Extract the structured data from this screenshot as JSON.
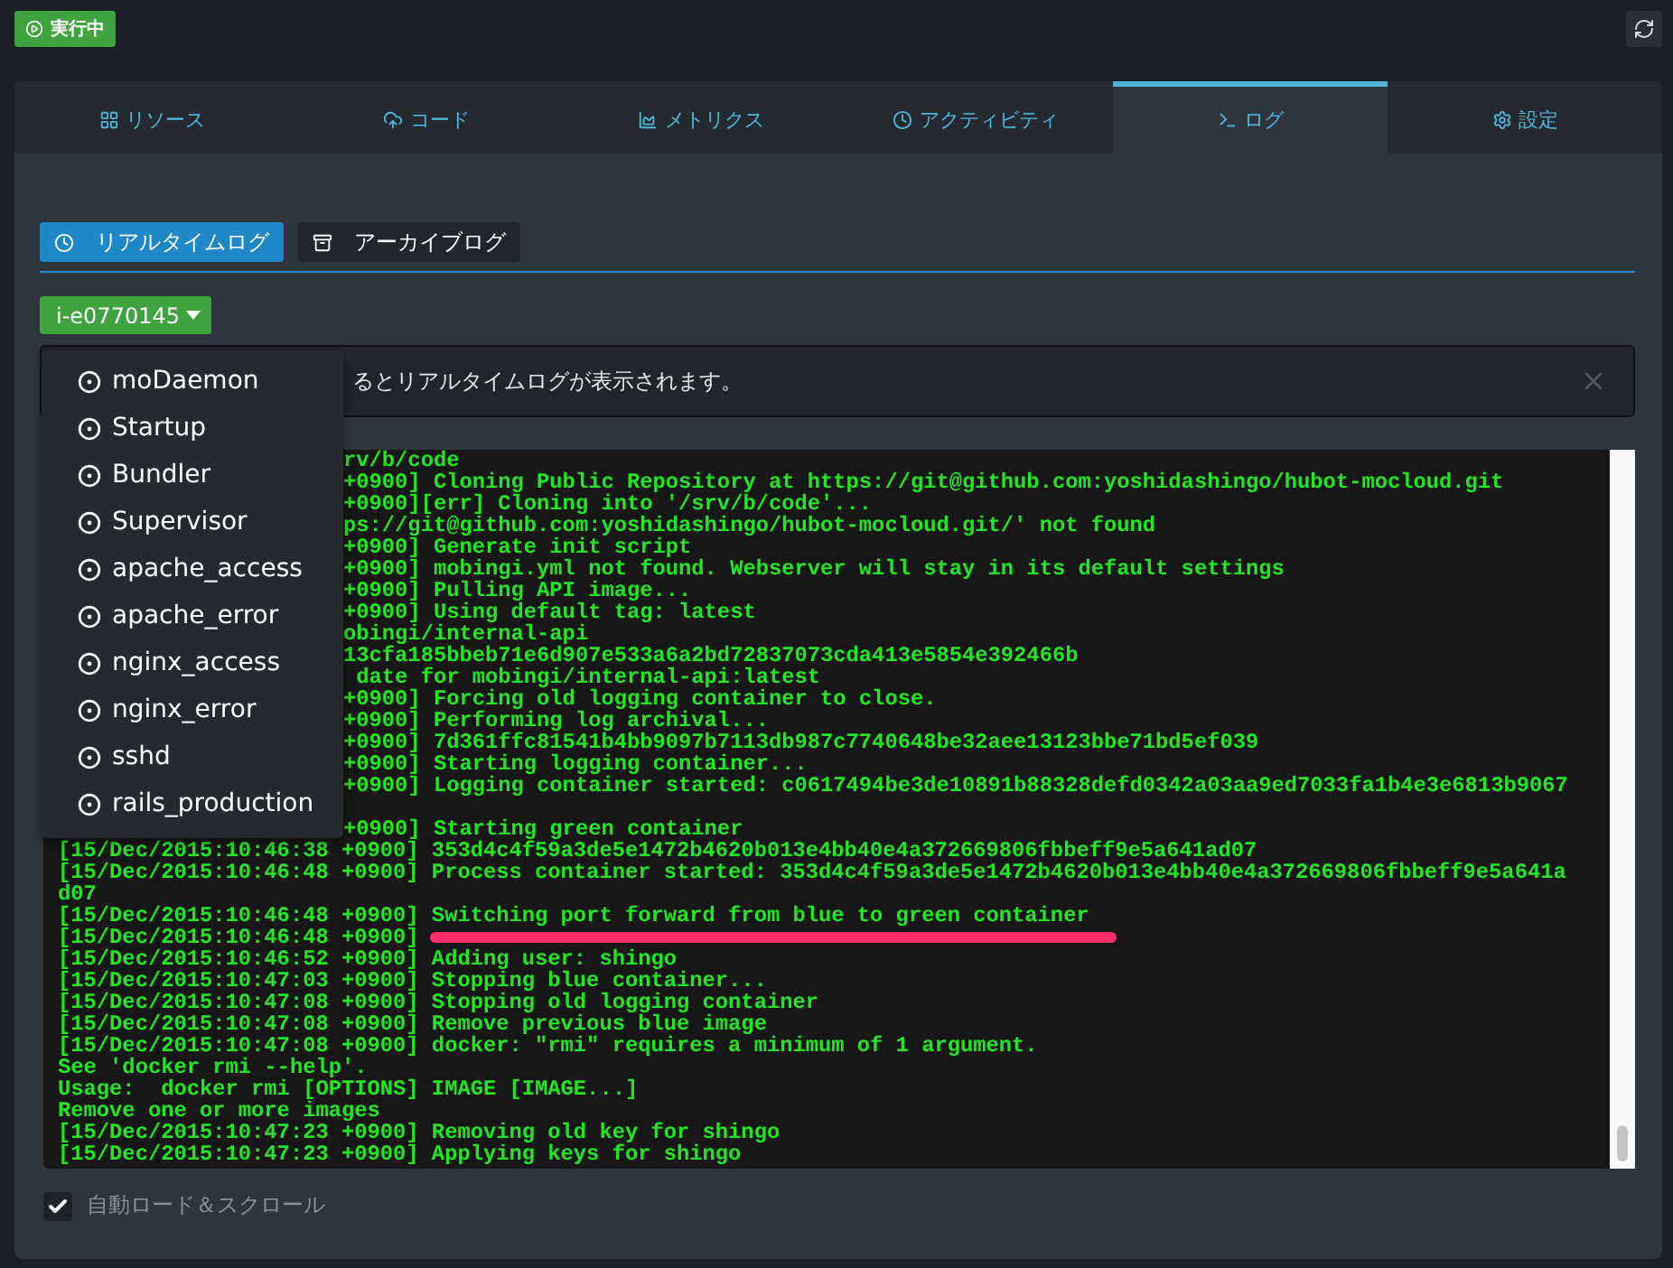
{
  "status": {
    "label": "実行中"
  },
  "tabs": [
    {
      "label": "リソース",
      "selected": false
    },
    {
      "label": "コード",
      "selected": false
    },
    {
      "label": "メトリクス",
      "selected": false
    },
    {
      "label": "アクティビティ",
      "selected": false
    },
    {
      "label": "ログ",
      "selected": true
    },
    {
      "label": "設定",
      "selected": false
    }
  ],
  "log_modes": [
    {
      "label": "リアルタイムログ",
      "selected": true
    },
    {
      "label": "アーカイブログ",
      "selected": false
    }
  ],
  "instance": {
    "label": "i-e0770145",
    "expanded": true
  },
  "menu_items": [
    "moDaemon",
    "Startup",
    "Bundler",
    "Supervisor",
    "apache_access",
    "apache_error",
    "nginx_access",
    "nginx_error",
    "sshd",
    "rails_production"
  ],
  "alert": {
    "text": "るとリアルタイムログが表示されます。"
  },
  "log_lines": [
    {
      "kind": "cut",
      "text": "rv/b/code"
    },
    {
      "kind": "cut",
      "text": "+0900] Cloning Public Repository at https://git@github.com:yoshidashingo/hubot-mocloud.git"
    },
    {
      "kind": "cut",
      "text": "+0900][err] Cloning into '/srv/b/code'..."
    },
    {
      "kind": "cut",
      "text": "ps://git@github.com:yoshidashingo/hubot-mocloud.git/' not found"
    },
    {
      "kind": "cut",
      "text": "+0900] Generate init script"
    },
    {
      "kind": "cut",
      "text": "+0900] mobingi.yml not found. Webserver will stay in its default settings"
    },
    {
      "kind": "cut",
      "text": "+0900] Pulling API image..."
    },
    {
      "kind": "cut",
      "text": "+0900] Using default tag: latest"
    },
    {
      "kind": "cut",
      "text": "obingi/internal-api"
    },
    {
      "kind": "cut",
      "text": "13cfa185bbeb71e6d907e533a6a2bd72837073cda413e5854e392466b"
    },
    {
      "kind": "cut",
      "text": " date for mobingi/internal-api:latest"
    },
    {
      "kind": "cut",
      "text": "+0900] Forcing old logging container to close."
    },
    {
      "kind": "cut",
      "text": "+0900] Performing log archival..."
    },
    {
      "kind": "cut",
      "text": "+0900] 7d361ffc81541b4bb9097b7113db987c7740648be32aee13123bbe71bd5ef039"
    },
    {
      "kind": "cut",
      "text": "+0900] Starting logging container..."
    },
    {
      "kind": "cut",
      "text": "+0900] Logging container started: c0617494be3de10891b88328defd0342a03aa9ed7033fa1b4e3e6813b9067"
    },
    {
      "kind": "blank"
    },
    {
      "kind": "cut",
      "text": "+0900] Starting green container"
    },
    {
      "kind": "full",
      "text": "[15/Dec/2015:10:46:38 +0900] 353d4c4f59a3de5e1472b4620b013e4bb40e4a372669806fbbeff9e5a641ad07"
    },
    {
      "kind": "full",
      "text": "[15/Dec/2015:10:46:48 +0900] Process container started: 353d4c4f59a3de5e1472b4620b013e4bb40e4a372669806fbbeff9e5a641a"
    },
    {
      "kind": "full",
      "text": "d07"
    },
    {
      "kind": "full",
      "text": "[15/Dec/2015:10:46:48 +0900] Switching port forward from blue to green container"
    },
    {
      "kind": "redacted",
      "text": "[15/Dec/2015:10:46:48 +0900]"
    },
    {
      "kind": "full",
      "text": "[15/Dec/2015:10:46:52 +0900] Adding user: shingo"
    },
    {
      "kind": "full",
      "text": "[15/Dec/2015:10:47:03 +0900] Stopping blue container..."
    },
    {
      "kind": "full",
      "text": "[15/Dec/2015:10:47:08 +0900] Stopping old logging container"
    },
    {
      "kind": "full",
      "text": "[15/Dec/2015:10:47:08 +0900] Remove previous blue image"
    },
    {
      "kind": "full",
      "text": "[15/Dec/2015:10:47:08 +0900] docker: \"rmi\" requires a minimum of 1 argument."
    },
    {
      "kind": "full",
      "text": "See 'docker rmi --help'."
    },
    {
      "kind": "full",
      "text": "Usage:  docker rmi [OPTIONS] IMAGE [IMAGE...]"
    },
    {
      "kind": "full",
      "text": "Remove one or more images"
    },
    {
      "kind": "full",
      "text": "[15/Dec/2015:10:47:23 +0900] Removing old key for shingo"
    },
    {
      "kind": "full",
      "text": "[15/Dec/2015:10:47:23 +0900] Applying keys for shingo"
    }
  ],
  "auto_scroll": {
    "label": "自動ロード＆スクロール",
    "checked": true
  }
}
